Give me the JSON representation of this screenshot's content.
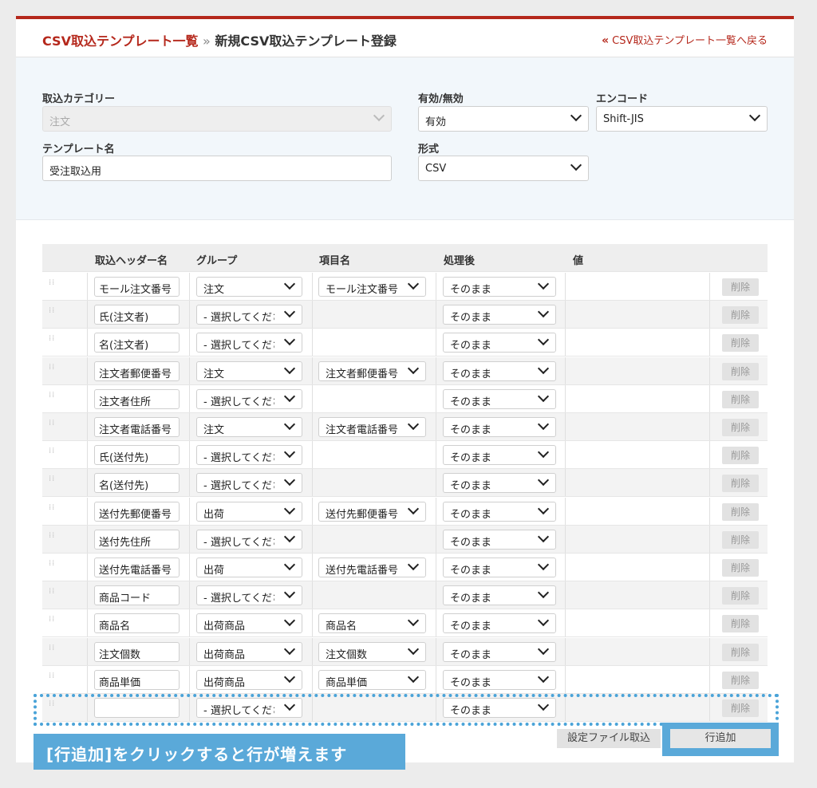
{
  "breadcrumb": {
    "parent": "CSV取込テンプレート一覧",
    "separator": "»",
    "current": "新規CSV取込テンプレート登録"
  },
  "back_link": {
    "icon": "double-chevron-left-icon",
    "label": "CSV取込テンプレート一覧へ戻る"
  },
  "form": {
    "category_label": "取込カテゴリー",
    "category_value": "注文",
    "enabled_label": "有効/無効",
    "enabled_value": "有効",
    "encode_label": "エンコード",
    "encode_value": "Shift-JIS",
    "template_name_label": "テンプレート名",
    "template_name_value": "受注取込用",
    "format_label": "形式",
    "format_value": "CSV"
  },
  "table": {
    "headers": [
      "取込ヘッダー名",
      "グループ",
      "項目名",
      "処理後",
      "値"
    ],
    "delete_label": "削除",
    "rows": [
      {
        "header": "モール注文番号",
        "group": "注文",
        "item": "モール注文番号",
        "after": "そのまま",
        "value": ""
      },
      {
        "header": "氏(注文者)",
        "group": "- 選択してください",
        "item": "",
        "after": "そのまま",
        "value": ""
      },
      {
        "header": "名(注文者)",
        "group": "- 選択してください",
        "item": "",
        "after": "そのまま",
        "value": ""
      },
      {
        "header": "注文者郵便番号",
        "group": "注文",
        "item": "注文者郵便番号",
        "after": "そのまま",
        "value": ""
      },
      {
        "header": "注文者住所",
        "group": "- 選択してください",
        "item": "",
        "after": "そのまま",
        "value": ""
      },
      {
        "header": "注文者電話番号",
        "group": "注文",
        "item": "注文者電話番号",
        "after": "そのまま",
        "value": ""
      },
      {
        "header": "氏(送付先)",
        "group": "- 選択してください",
        "item": "",
        "after": "そのまま",
        "value": ""
      },
      {
        "header": "名(送付先)",
        "group": "- 選択してください",
        "item": "",
        "after": "そのまま",
        "value": ""
      },
      {
        "header": "送付先郵便番号",
        "group": "出荷",
        "item": "送付先郵便番号",
        "after": "そのまま",
        "value": ""
      },
      {
        "header": "送付先住所",
        "group": "- 選択してください",
        "item": "",
        "after": "そのまま",
        "value": ""
      },
      {
        "header": "送付先電話番号",
        "group": "出荷",
        "item": "送付先電話番号",
        "after": "そのまま",
        "value": ""
      },
      {
        "header": "商品コード",
        "group": "- 選択してください",
        "item": "",
        "after": "そのまま",
        "value": ""
      },
      {
        "header": "商品名",
        "group": "出荷商品",
        "item": "商品名",
        "after": "そのまま",
        "value": ""
      },
      {
        "header": "注文個数",
        "group": "出荷商品",
        "item": "注文個数",
        "after": "そのまま",
        "value": ""
      },
      {
        "header": "商品単価",
        "group": "出荷商品",
        "item": "商品単価",
        "after": "そのまま",
        "value": ""
      },
      {
        "header": "",
        "group": "- 選択してください",
        "item": "",
        "after": "そのまま",
        "value": ""
      }
    ]
  },
  "buttons": {
    "import_settings": "設定ファイル取込",
    "add_row": "行追加"
  },
  "callout": "[行追加]をクリックすると行が増えます",
  "colors": {
    "accent": "#b5281c",
    "highlight": "#5aa9d9"
  }
}
